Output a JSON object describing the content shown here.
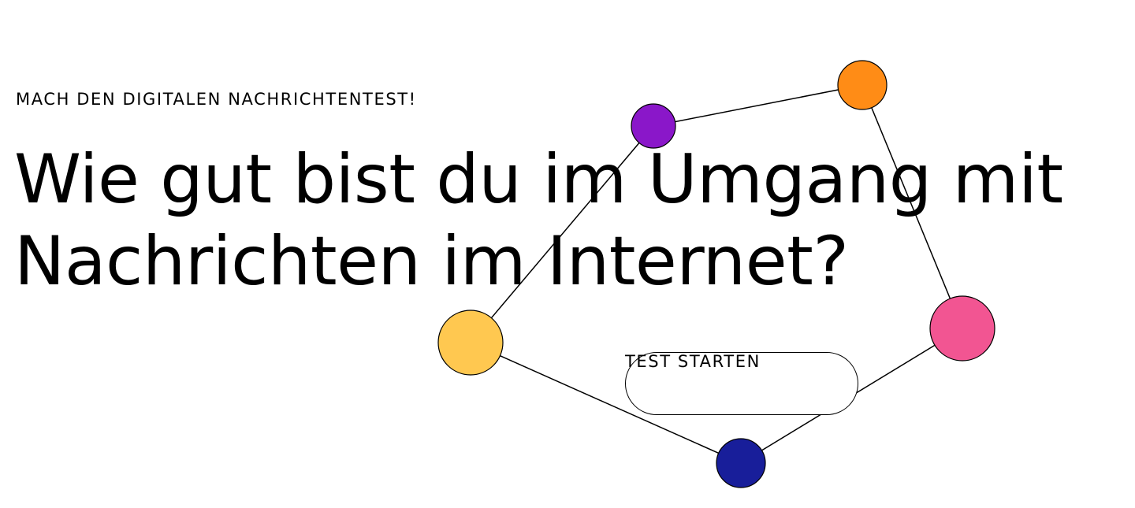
{
  "hero": {
    "eyebrow": "MACH DEN DIGITALEN NACHRICHTENTEST!",
    "headline_line1": "Wie gut bist du im Umgang mit",
    "headline_line2": "Nachrichten im Internet?",
    "cta_label": "TEST STARTEN"
  },
  "network": {
    "node_colors": {
      "purple": "#8a17c9",
      "orange": "#ff8c16",
      "pink": "#f25592",
      "navy": "#181e9a",
      "yellow": "#ffc850"
    },
    "connections": [
      [
        "yellow",
        "purple"
      ],
      [
        "purple",
        "orange"
      ],
      [
        "orange",
        "pink"
      ],
      [
        "pink",
        "navy"
      ],
      [
        "navy",
        "yellow"
      ]
    ]
  }
}
